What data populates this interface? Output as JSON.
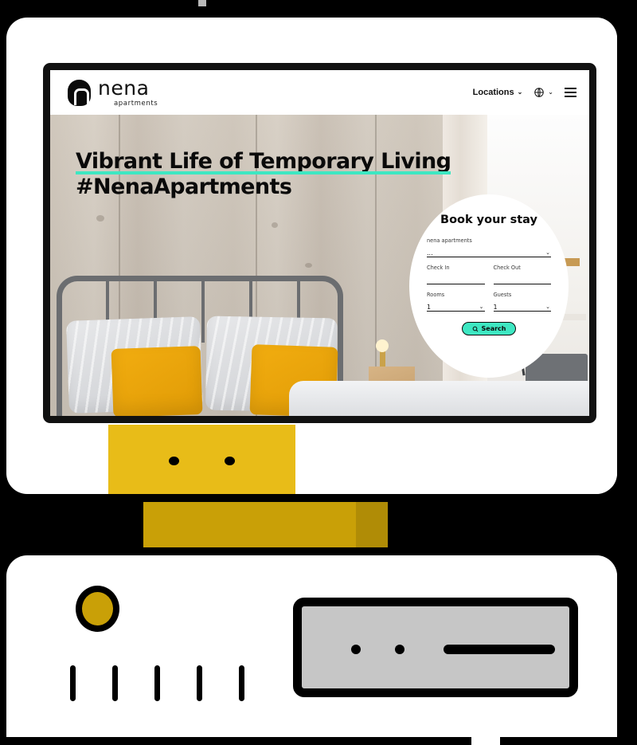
{
  "scene": {
    "title": "nena apartments website on desktop monitor illustration"
  },
  "site": {
    "brand": {
      "name": "nena",
      "subtitle": "apartments",
      "mark_icon": "nena-logo-icon"
    },
    "nav": {
      "locations_label": "Locations",
      "locations_chevron": "⌄",
      "globe_icon": "globe-icon",
      "globe_chevron": "⌄",
      "menu_icon": "hamburger-menu-icon"
    },
    "hero": {
      "headline_line_1": "Vibrant Life of Temporary Living",
      "headline_line_2": "#NenaApartments",
      "underline_color": "#3ee7c2"
    },
    "booking": {
      "title": "Book your stay",
      "property": {
        "label": "nena apartments",
        "value": "...",
        "chevron": "⌄"
      },
      "check_in": {
        "label": "Check In",
        "value": ""
      },
      "check_out": {
        "label": "Check Out",
        "value": ""
      },
      "rooms": {
        "label": "Rooms",
        "value": "1",
        "chevron": "⌄"
      },
      "guests": {
        "label": "Guests",
        "value": "1",
        "chevron": "⌄"
      },
      "search_button": {
        "label": "Search",
        "icon": "search-icon"
      }
    }
  },
  "colors": {
    "accent_teal": "#3ee7c2",
    "yellow_bright": "#e8bc18",
    "yellow_dark": "#c9a007",
    "yellow_darker": "#b08c06",
    "frame_black": "#111111",
    "panel_white": "#ffffff",
    "panel_shade": "#e3e3e3",
    "grille_gray": "#c6c6c6"
  }
}
